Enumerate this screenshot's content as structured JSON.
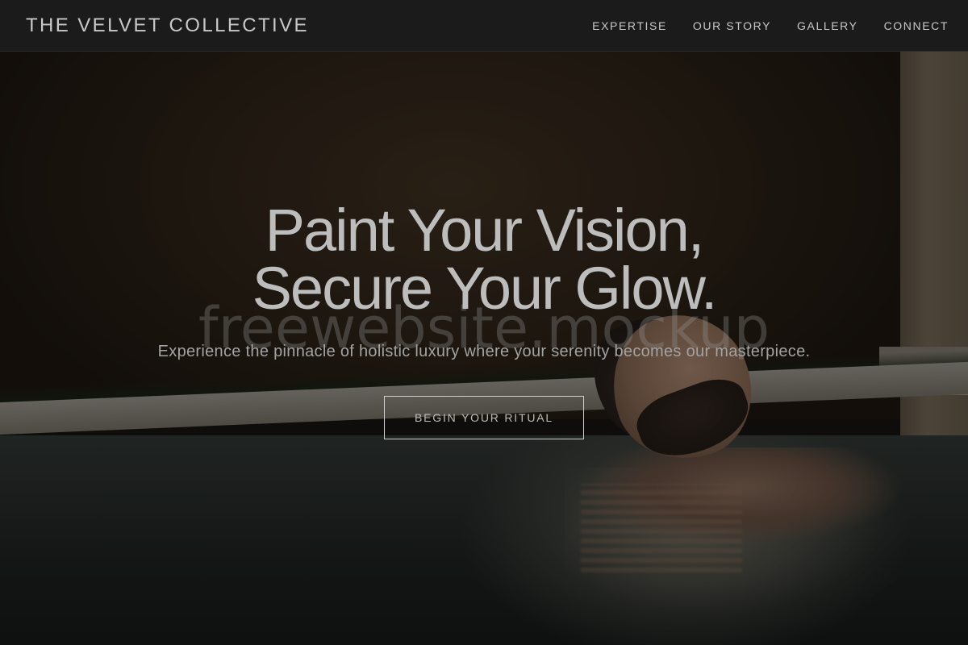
{
  "header": {
    "brand": "THE VELVET COLLECTIVE",
    "nav": [
      {
        "label": "EXPERTISE"
      },
      {
        "label": "OUR STORY"
      },
      {
        "label": "GALLERY"
      },
      {
        "label": "CONNECT"
      }
    ]
  },
  "hero": {
    "title_line1": "Paint Your Vision,",
    "title_line2": "Secure Your Glow.",
    "subtitle": "Experience the pinnacle of holistic luxury where your serenity becomes our masterpiece.",
    "cta_label": "BEGIN YOUR RITUAL",
    "watermark": "freewebsite.mockup"
  },
  "colors": {
    "navbar_bg": "#1b1b1b",
    "text_light": "#c9c9c9",
    "overlay": "rgba(0,0,0,0.45)"
  }
}
